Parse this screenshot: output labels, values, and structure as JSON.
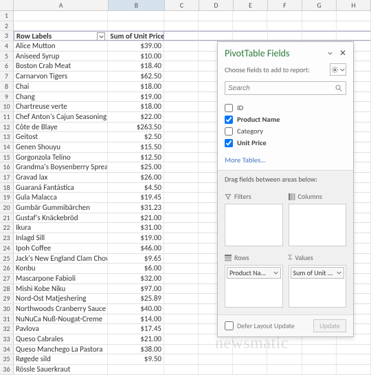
{
  "columns": [
    "A",
    "B",
    "C",
    "D",
    "E",
    "F",
    "G",
    "H"
  ],
  "selected_column": "B",
  "pivot_header": {
    "row_labels": "Row Labels",
    "values": "Sum of Unit Price"
  },
  "rows": [
    {
      "n": 1,
      "a": "",
      "b": ""
    },
    {
      "n": 2,
      "a": "",
      "b": ""
    },
    {
      "n": 3,
      "a": "__HDR__",
      "b": "__HDR__"
    },
    {
      "n": 4,
      "a": "Alice Mutton",
      "b": "$39.00"
    },
    {
      "n": 5,
      "a": "Aniseed Syrup",
      "b": "$10.00"
    },
    {
      "n": 6,
      "a": "Boston Crab Meat",
      "b": "$18.40"
    },
    {
      "n": 7,
      "a": "Carnarvon Tigers",
      "b": "$62.50"
    },
    {
      "n": 8,
      "a": "Chai",
      "b": "$18.00"
    },
    {
      "n": 9,
      "a": "Chang",
      "b": "$19.00"
    },
    {
      "n": 10,
      "a": "Chartreuse verte",
      "b": "$18.00"
    },
    {
      "n": 11,
      "a": "Chef Anton's Cajun Seasoning",
      "b": "$22.00"
    },
    {
      "n": 12,
      "a": "Côte de Blaye",
      "b": "$263.50"
    },
    {
      "n": 13,
      "a": "Geitost",
      "b": "$2.50"
    },
    {
      "n": 14,
      "a": "Genen Shouyu",
      "b": "$15.50"
    },
    {
      "n": 15,
      "a": "Gorgonzola Telino",
      "b": "$12.50"
    },
    {
      "n": 16,
      "a": "Grandma's Boysenberry Spread",
      "b": "$25.00"
    },
    {
      "n": 17,
      "a": "Gravad lax",
      "b": "$26.00"
    },
    {
      "n": 18,
      "a": "Guaraná Fantástica",
      "b": "$4.50"
    },
    {
      "n": 19,
      "a": "Gula Malacca",
      "b": "$19.45"
    },
    {
      "n": 20,
      "a": "Gumbär Gummibärchen",
      "b": "$31.23"
    },
    {
      "n": 21,
      "a": "Gustaf's Knäckebröd",
      "b": "$21.00"
    },
    {
      "n": 22,
      "a": "Ikura",
      "b": "$31.00"
    },
    {
      "n": 23,
      "a": "Inlagd Sill",
      "b": "$19.00"
    },
    {
      "n": 24,
      "a": "Ipoh Coffee",
      "b": "$46.00"
    },
    {
      "n": 25,
      "a": "Jack's New England Clam Chowder",
      "b": "$9.65"
    },
    {
      "n": 26,
      "a": "Konbu",
      "b": "$6.00"
    },
    {
      "n": 27,
      "a": "Mascarpone Fabioli",
      "b": "$32.00"
    },
    {
      "n": 28,
      "a": "Mishi Kobe Niku",
      "b": "$97.00"
    },
    {
      "n": 29,
      "a": "Nord-Ost Matjeshering",
      "b": "$25.89"
    },
    {
      "n": 30,
      "a": "Northwoods Cranberry Sauce",
      "b": "$40.00"
    },
    {
      "n": 31,
      "a": "NuNuCa Nuß-Nougat-Creme",
      "b": "$14.00"
    },
    {
      "n": 32,
      "a": "Pavlova",
      "b": "$17.45"
    },
    {
      "n": 33,
      "a": "Queso Cabrales",
      "b": "$21.00"
    },
    {
      "n": 34,
      "a": "Queso Manchego La Pastora",
      "b": "$38.00"
    },
    {
      "n": 35,
      "a": "Røgede sild",
      "b": "$9.50"
    },
    {
      "n": 36,
      "a": "Rössle Sauerkraut",
      "b": ""
    }
  ],
  "pane": {
    "title": "PivotTable Fields",
    "choose_label": "Choose fields to add to report:",
    "search_placeholder": "Search",
    "fields": [
      {
        "label": "ID",
        "checked": false
      },
      {
        "label": "Product Name",
        "checked": true
      },
      {
        "label": "Category",
        "checked": false
      },
      {
        "label": "Unit Price",
        "checked": true
      }
    ],
    "more_tables": "More Tables...",
    "drag_label": "Drag fields between areas below:",
    "areas": {
      "filters": {
        "label": "Filters",
        "items": []
      },
      "columns": {
        "label": "Columns",
        "items": []
      },
      "rows": {
        "label": "Rows",
        "items": [
          "Product Na..."
        ]
      },
      "values": {
        "label": "Values",
        "items": [
          "Sum of Unit ..."
        ]
      }
    },
    "defer_label": "Defer Layout Update",
    "update_label": "Update"
  },
  "watermark": "newsmatic"
}
